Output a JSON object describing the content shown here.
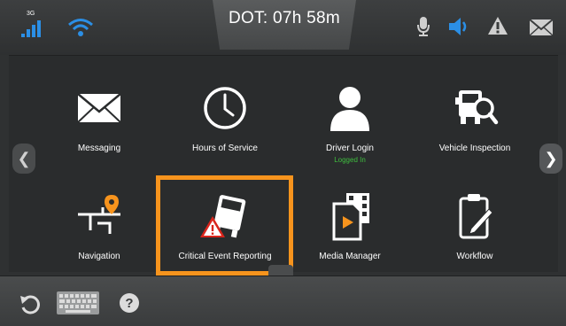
{
  "status": {
    "signal_label": "3G",
    "dot_label": "DOT: 07h 58m"
  },
  "tiles": [
    {
      "label": "Messaging",
      "icon": "envelope-icon"
    },
    {
      "label": "Hours of Service",
      "icon": "clock-icon"
    },
    {
      "label": "Driver Login",
      "sublabel": "Logged In",
      "icon": "person-icon"
    },
    {
      "label": "Vehicle Inspection",
      "icon": "truck-inspect-icon"
    },
    {
      "label": "Navigation",
      "icon": "navigation-icon"
    },
    {
      "label": "Critical Event Reporting",
      "icon": "critical-event-icon"
    },
    {
      "label": "Media Manager",
      "icon": "media-icon"
    },
    {
      "label": "Workflow",
      "icon": "workflow-icon"
    }
  ],
  "colors": {
    "accent_blue": "#2b8fe6",
    "highlight_orange": "#f7941d",
    "logged_in_green": "#3fbf3f",
    "warning_red": "#d9251c"
  }
}
